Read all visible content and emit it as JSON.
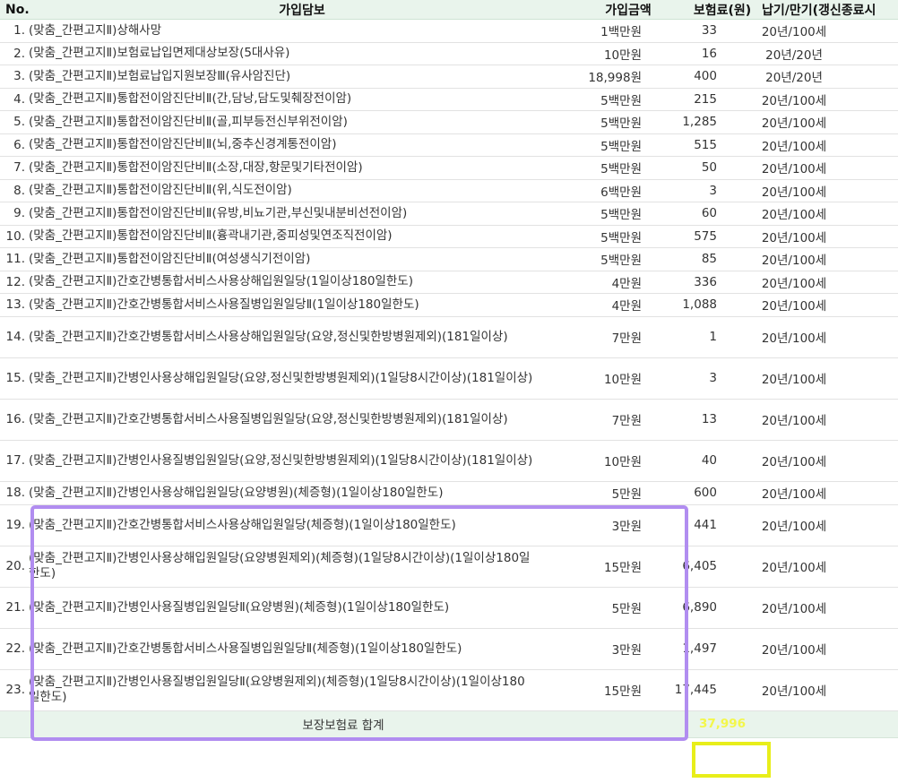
{
  "table": {
    "headers": {
      "no": "No.",
      "coverage": "가입담보",
      "amount": "가입금액",
      "premium": "보험료(원)",
      "term": "납기/만기(갱신종료시"
    },
    "rows": [
      {
        "no": "1.",
        "name": "(맞춤_간편고지Ⅱ)상해사망",
        "amount": "1백만원",
        "premium": "33",
        "term": "20년/100세"
      },
      {
        "no": "2.",
        "name": "(맞춤_간편고지Ⅱ)보험료납입면제대상보장(5대사유)",
        "amount": "10만원",
        "premium": "16",
        "term": "20년/20년"
      },
      {
        "no": "3.",
        "name": "(맞춤_간편고지Ⅱ)보험료납입지원보장Ⅲ(유사암진단)",
        "amount": "18,998원",
        "premium": "400",
        "term": "20년/20년"
      },
      {
        "no": "4.",
        "name": "(맞춤_간편고지Ⅱ)통합전이암진단비Ⅱ(간,담낭,담도및췌장전이암)",
        "amount": "5백만원",
        "premium": "215",
        "term": "20년/100세"
      },
      {
        "no": "5.",
        "name": "(맞춤_간편고지Ⅱ)통합전이암진단비Ⅱ(골,피부등전신부위전이암)",
        "amount": "5백만원",
        "premium": "1,285",
        "term": "20년/100세"
      },
      {
        "no": "6.",
        "name": "(맞춤_간편고지Ⅱ)통합전이암진단비Ⅱ(뇌,중추신경계통전이암)",
        "amount": "5백만원",
        "premium": "515",
        "term": "20년/100세"
      },
      {
        "no": "7.",
        "name": "(맞춤_간편고지Ⅱ)통합전이암진단비Ⅱ(소장,대장,항문및기타전이암)",
        "amount": "5백만원",
        "premium": "50",
        "term": "20년/100세"
      },
      {
        "no": "8.",
        "name": "(맞춤_간편고지Ⅱ)통합전이암진단비Ⅱ(위,식도전이암)",
        "amount": "6백만원",
        "premium": "3",
        "term": "20년/100세"
      },
      {
        "no": "9.",
        "name": "(맞춤_간편고지Ⅱ)통합전이암진단비Ⅱ(유방,비뇨기관,부신및내분비선전이암)",
        "amount": "5백만원",
        "premium": "60",
        "term": "20년/100세"
      },
      {
        "no": "10.",
        "name": "(맞춤_간편고지Ⅱ)통합전이암진단비Ⅱ(흉곽내기관,중피성및연조직전이암)",
        "amount": "5백만원",
        "premium": "575",
        "term": "20년/100세"
      },
      {
        "no": "11.",
        "name": "(맞춤_간편고지Ⅱ)통합전이암진단비Ⅱ(여성생식기전이암)",
        "amount": "5백만원",
        "premium": "85",
        "term": "20년/100세"
      },
      {
        "no": "12.",
        "name": "(맞춤_간편고지Ⅱ)간호간병통합서비스사용상해입원일당(1일이상180일한도)",
        "amount": "4만원",
        "premium": "336",
        "term": "20년/100세"
      },
      {
        "no": "13.",
        "name": "(맞춤_간편고지Ⅱ)간호간병통합서비스사용질병입원일당Ⅱ(1일이상180일한도)",
        "amount": "4만원",
        "premium": "1,088",
        "term": "20년/100세"
      },
      {
        "no": "14.",
        "name": "(맞춤_간편고지Ⅱ)간호간병통합서비스사용상해입원일당(요양,정신및한방병원제외)(181일이상)",
        "amount": "7만원",
        "premium": "1",
        "term": "20년/100세"
      },
      {
        "no": "15.",
        "name": "(맞춤_간편고지Ⅱ)간병인사용상해입원일당(요양,정신및한방병원제외)(1일당8시간이상)(181일이상)",
        "amount": "10만원",
        "premium": "3",
        "term": "20년/100세"
      },
      {
        "no": "16.",
        "name": "(맞춤_간편고지Ⅱ)간호간병통합서비스사용질병입원일당(요양,정신및한방병원제외)(181일이상)",
        "amount": "7만원",
        "premium": "13",
        "term": "20년/100세"
      },
      {
        "no": "17.",
        "name": "(맞춤_간편고지Ⅱ)간병인사용질병입원일당(요양,정신및한방병원제외)(1일당8시간이상)(181일이상)",
        "amount": "10만원",
        "premium": "40",
        "term": "20년/100세"
      },
      {
        "no": "18.",
        "name": "(맞춤_간편고지Ⅱ)간병인사용상해입원일당(요양병원)(체증형)(1일이상180일한도)",
        "amount": "5만원",
        "premium": "600",
        "term": "20년/100세"
      },
      {
        "no": "19.",
        "name": "(맞춤_간편고지Ⅱ)간호간병통합서비스사용상해입원일당(체증형)(1일이상180일한도)",
        "amount": "3만원",
        "premium": "441",
        "term": "20년/100세"
      },
      {
        "no": "20.",
        "name": "(맞춤_간편고지Ⅱ)간병인사용상해입원일당(요양병원제외)(체증형)(1일당8시간이상)(1일이상180일한도)",
        "amount": "15만원",
        "premium": "6,405",
        "term": "20년/100세"
      },
      {
        "no": "21.",
        "name": "(맞춤_간편고지Ⅱ)간병인사용질병입원일당Ⅱ(요양병원)(체증형)(1일이상180일한도)",
        "amount": "5만원",
        "premium": "6,890",
        "term": "20년/100세"
      },
      {
        "no": "22.",
        "name": "(맞춤_간편고지Ⅱ)간호간병통합서비스사용질병입원일당Ⅱ(체증형)(1일이상180일한도)",
        "amount": "3만원",
        "premium": "1,497",
        "term": "20년/100세"
      },
      {
        "no": "23.",
        "name": "(맞춤_간편고지Ⅱ)간병인사용질병입원일당Ⅱ(요양병원제외)(체증형)(1일당8시간이상)(1일이상180일한도)",
        "amount": "15만원",
        "premium": "17,445",
        "term": "20년/100세"
      }
    ],
    "total": {
      "label": "보장보험료 합계",
      "value": "37,996"
    }
  },
  "colors": {
    "header_bg": "#e9f4ec",
    "highlight_purple": "#b18df0",
    "highlight_yellow": "#e8ee1a",
    "total_text": "#f3f74a"
  }
}
